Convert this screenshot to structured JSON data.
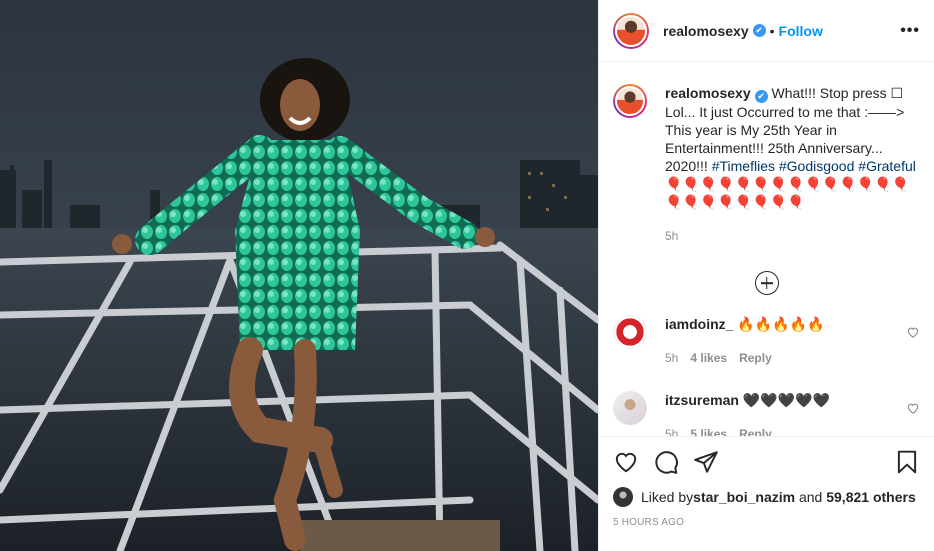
{
  "post": {
    "username": "realomosexy",
    "verified_mark": "✔",
    "separator": "•",
    "follow_label": "Follow",
    "more_label": "•••"
  },
  "caption": {
    "username": "realomosexy",
    "text_1": " What!!! Stop press ☐ Lol... It just Occurred to me that :——> This year is My 25th Year in Entertainment!!! 25th Anniversary... 2020!!! ",
    "hashtag_1": "#Timeflies",
    "hashtag_2": "#Godisgood",
    "hashtag_3": "#Grateful",
    "text_2": " 🎈🎈🎈🎈🎈🎈🎈🎈🎈🎈🎈🎈🎈🎈🎈🎈🎈🎈🎈🎈🎈🎈",
    "time": "5h"
  },
  "comments": [
    {
      "username": "iamdoinz_",
      "text": "🔥🔥🔥🔥🔥",
      "time": "5h",
      "likes": "4 likes",
      "reply": "Reply"
    },
    {
      "username": "itzsureman",
      "text": "🖤🖤🖤🖤🖤",
      "time": "5h",
      "likes": "5 likes",
      "reply": "Reply"
    }
  ],
  "likes": {
    "prefix": "Liked by ",
    "user": "star_boi_nazim",
    "and": " and ",
    "others": "59,821 others"
  },
  "timestamp": "5 HOURS AGO",
  "icons": [
    "heart-icon",
    "comment-icon",
    "share-icon",
    "bookmark-icon",
    "add-comment-icon",
    "verified-icon"
  ],
  "colors": {
    "link": "#0095f6",
    "hashtag": "#00376b",
    "muted": "#8e8e8e",
    "verified": "#3897f0"
  }
}
